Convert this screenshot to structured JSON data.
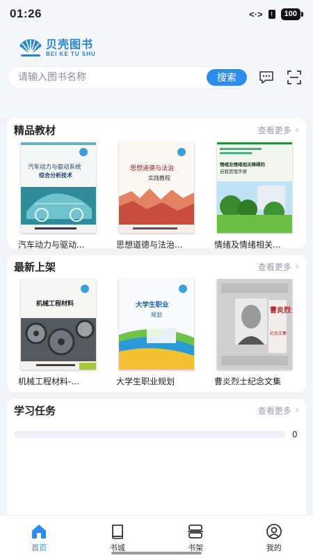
{
  "status_bar": {
    "time": "01:26",
    "network_icon": "<·>",
    "sim_icon": "!",
    "battery": "100"
  },
  "logo": {
    "cn": "贝壳图书",
    "en": "BEI KE TU SHU"
  },
  "search": {
    "placeholder": "请输入图书名称",
    "button_label": "搜索"
  },
  "sections": {
    "featured": {
      "title": "精品教材",
      "more_label": "查看更多",
      "books": [
        {
          "name": "汽车动力与驱动...",
          "cover_title": "汽车动力与驱动系统",
          "cover_subtitle": "综合分析技术"
        },
        {
          "name": "思想道德与法治...",
          "cover_title": "思想道德与法治",
          "cover_subtitle": "实践教程"
        },
        {
          "name": "情绪及情绪相关...",
          "cover_title": "情绪及情绪相关障碍的",
          "cover_subtitle": "自我管理手册"
        }
      ]
    },
    "new": {
      "title": "最新上架",
      "more_label": "查看更多",
      "books": [
        {
          "name": "机械工程材料-...",
          "cover_title": "机械工程材料"
        },
        {
          "name": "大学生职业规划",
          "cover_title": "大学生职业",
          "cover_subtitle": "规划"
        },
        {
          "name": "曹炎烈士纪念文集",
          "cover_title": "曹炎烈士",
          "cover_subtitle": "纪念文集"
        }
      ]
    },
    "tasks": {
      "title": "学习任务",
      "more_label": "查看更多",
      "progress_value": "0",
      "progress_fraction": 0
    }
  },
  "tabbar": {
    "items": [
      {
        "label": "首页",
        "icon": "home-icon",
        "active": true
      },
      {
        "label": "书城",
        "icon": "book-icon",
        "active": false
      },
      {
        "label": "书架",
        "icon": "bookshelf-icon",
        "active": false
      },
      {
        "label": "我的",
        "icon": "profile-icon",
        "active": false
      }
    ]
  },
  "colors": {
    "accent": "#2d8cf0",
    "logo": "#2a86c8"
  }
}
